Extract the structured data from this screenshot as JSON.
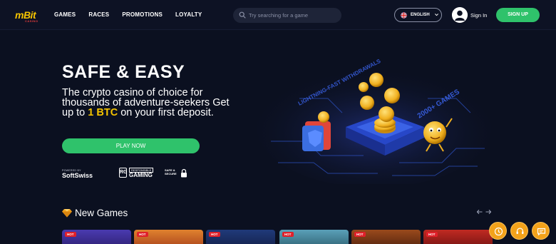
{
  "header": {
    "logo": "mBit",
    "logo_sub": "CASINO",
    "nav": [
      "GAMES",
      "RACES",
      "PROMOTIONS",
      "LOYALTY"
    ],
    "search_placeholder": "Try searching for a game",
    "language": "ENGLISH",
    "sign_in": "Sign In",
    "sign_up": "SIGN UP"
  },
  "hero": {
    "title": "SAFE & EASY",
    "line1": "The crypto casino of choice for thousands of adventure-seekers",
    "line2_pre": "Get up to ",
    "line2_highlight": "1 BTC",
    "line2_post": " on your first deposit.",
    "play_button": "PLAY NOW"
  },
  "partners": {
    "softswiss_small": "POWERED BY",
    "softswiss": "SoftSwiss",
    "rg_box": "RG",
    "rg_small": "RESPONSIBLE",
    "rg": "GAMING",
    "safe_line1": "SAFE &",
    "safe_line2": "SECURE"
  },
  "illustration": {
    "left_text": "LIGHTNING-FAST WITHDRAWALS",
    "right_text": "2000+ GAMES"
  },
  "new_games": {
    "title": "New Games",
    "badge": "HOT",
    "tiles": [
      {
        "color": "#3a2a8a"
      },
      {
        "color": "#c8622a"
      },
      {
        "color": "#1d2f6e"
      },
      {
        "color": "#3f7f9a"
      },
      {
        "color": "#7a3a1a"
      },
      {
        "color": "#9a1c1c"
      }
    ]
  },
  "colors": {
    "accent_green": "#2fc26b",
    "highlight_yellow": "#f5c400",
    "fab_orange": "#f3a21a",
    "background": "#0b1020"
  },
  "icons": {
    "search": "search-icon",
    "flag": "uk-flag-icon",
    "chevron": "chevron-down-icon",
    "user": "user-avatar-icon",
    "diamond": "diamond-icon",
    "arrow_left": "arrow-left-icon",
    "arrow_right": "arrow-right-icon",
    "fabs": [
      "clock-icon",
      "support-icon",
      "chat-icon"
    ]
  }
}
